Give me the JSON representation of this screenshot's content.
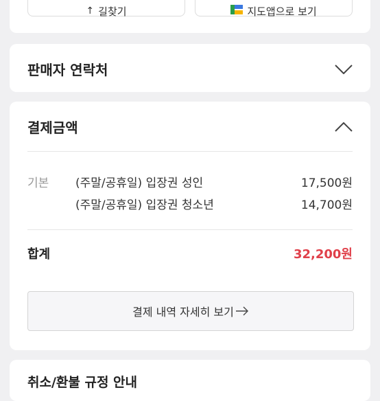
{
  "top_buttons": {
    "left": {
      "label": "길찾기",
      "icon": "arrow-icon"
    },
    "right": {
      "label": "지도앱으로 보기",
      "icon": "map-app-icon"
    }
  },
  "seller_section": {
    "title": "판매자 연락처",
    "state": "collapsed"
  },
  "payment_section": {
    "title": "결제금액",
    "state": "expanded",
    "category": "기본",
    "items": [
      {
        "name": "(주말/공휴일) 입장권 성인",
        "price": "17,500원"
      },
      {
        "name": "(주말/공휴일) 입장권 청소년",
        "price": "14,700원"
      }
    ],
    "total_label": "합계",
    "total_value": "32,200원",
    "detail_button_label": "결제 내역 자세히 보기",
    "accent_color": "#e0404a"
  },
  "refund_section": {
    "title": "취소/환불 규정 안내"
  }
}
